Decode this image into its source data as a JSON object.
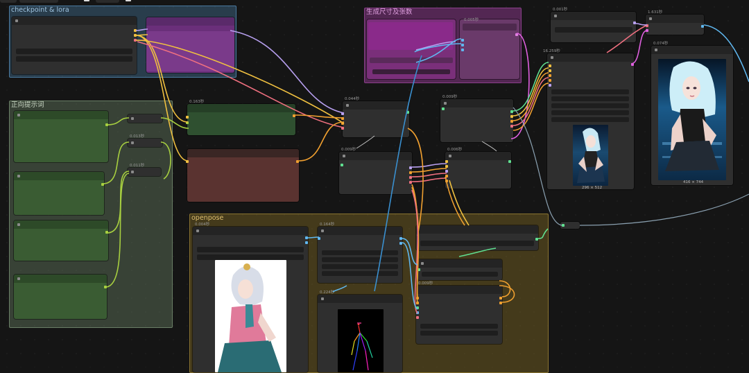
{
  "groups": {
    "checkpoint": "checkpoint & lora",
    "prompt": "正向提示词",
    "size": "生成尺寸及张数",
    "openpose": "openpose"
  },
  "times": {
    "t1": "0.163秒",
    "t2": "0.044秒",
    "t3": "0.009秒",
    "t4": "0.005秒",
    "t5": "0.003秒",
    "t6": "0.001秒",
    "t7": "1.631秒",
    "t8": "0.074秒",
    "t9": "16.259秒",
    "t10": "0.009秒",
    "t11": "0.013秒",
    "t12": "0.011秒",
    "t13": "0.006秒",
    "t14": "0.004秒",
    "t15": "0.164秒",
    "t16": "0.224秒",
    "t17": "0.009秒"
  },
  "previews": {
    "small_size": "296 × 512",
    "large_size": "416 × 744"
  },
  "colors": {
    "checkpoint_group": "#3a5f7a",
    "prompt_group": "#4e5e4a",
    "size_group": "#6e2f6e",
    "openpose_group": "#6b5a20",
    "wire_yellow": "#f0c040",
    "wire_orange": "#f0a030",
    "wire_pink": "#f07080",
    "wire_lavender": "#b8a0f0",
    "wire_lime": "#a8d040",
    "wire_blue": "#3a90d0",
    "wire_light_blue": "#60b8f0",
    "wire_green": "#60e090"
  }
}
